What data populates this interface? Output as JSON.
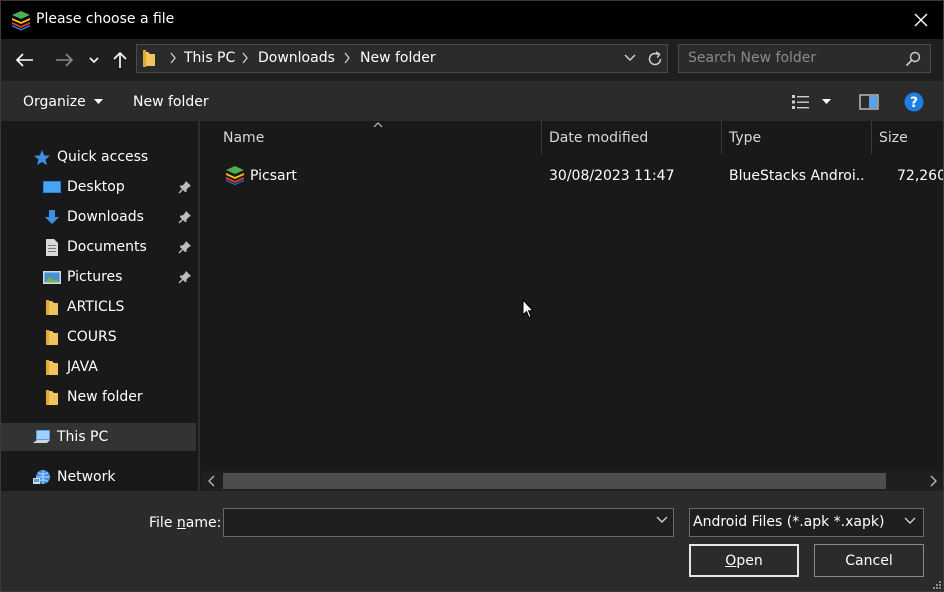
{
  "window": {
    "title": "Please choose a file"
  },
  "breadcrumb": [
    "This PC",
    "Downloads",
    "New folder"
  ],
  "search": {
    "placeholder": "Search New folder"
  },
  "toolbar": {
    "organize": "Organize",
    "new_folder": "New folder",
    "help": "?"
  },
  "sidebar": {
    "items": [
      {
        "label": "Quick access",
        "icon": "star-icon",
        "pinned": false
      },
      {
        "label": "Desktop",
        "icon": "desktop-icon",
        "pinned": true
      },
      {
        "label": "Downloads",
        "icon": "download-arrow-icon",
        "pinned": true
      },
      {
        "label": "Documents",
        "icon": "document-icon",
        "pinned": true
      },
      {
        "label": "Pictures",
        "icon": "pictures-icon",
        "pinned": true
      },
      {
        "label": "ARTICLS",
        "icon": "folder-icon",
        "pinned": false
      },
      {
        "label": "COURS",
        "icon": "folder-icon",
        "pinned": false
      },
      {
        "label": "JAVA",
        "icon": "folder-icon",
        "pinned": false
      },
      {
        "label": "New folder",
        "icon": "folder-icon",
        "pinned": false
      },
      {
        "label": "This PC",
        "icon": "computer-icon",
        "pinned": false,
        "selected": true
      },
      {
        "label": "Network",
        "icon": "network-icon",
        "pinned": false
      }
    ]
  },
  "columns": [
    "Name",
    "Date modified",
    "Type",
    "Size"
  ],
  "files": [
    {
      "name": "Picsart",
      "date_modified": "30/08/2023 11:47",
      "type": "BlueStacks Androi...",
      "size": "72,260"
    }
  ],
  "bottom": {
    "file_name_label_pre": "File ",
    "file_name_label_u": "n",
    "file_name_label_post": "ame:",
    "file_name_value": "",
    "filter": "Android Files (*.apk *.xapk)",
    "open_u": "O",
    "open_rest": "pen",
    "cancel": "Cancel"
  },
  "colors": {
    "titlebar": "#000000",
    "background": "#191919",
    "toolbar": "#2b2b2b",
    "selected": "#333333",
    "accent_blue": "#1e90ff",
    "folder_yellow": "#f2c55c"
  }
}
